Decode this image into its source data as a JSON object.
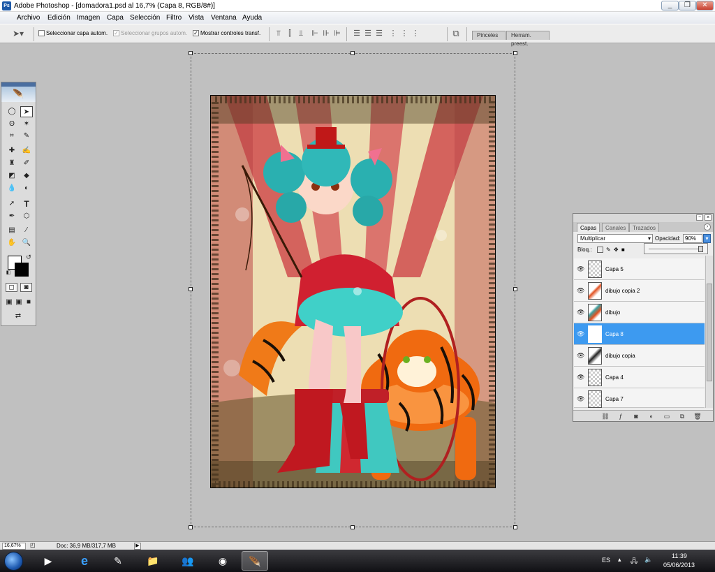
{
  "window": {
    "title": "Adobe Photoshop - [domadora1.psd al 16,7% (Capa 8, RGB/8#)]",
    "buttons": [
      "_",
      "❐",
      "✕"
    ],
    "doc_buttons": [
      "_",
      "❐",
      "✕"
    ]
  },
  "menu": [
    "Archivo",
    "Edición",
    "Imagen",
    "Capa",
    "Selección",
    "Filtro",
    "Vista",
    "Ventana",
    "Ayuda"
  ],
  "options": {
    "auto_select_layer": "Seleccionar capa autom.",
    "auto_select_groups": "Seleccionar grupos autom.",
    "show_transform": "Mostrar controles transf."
  },
  "palette_tabs": [
    "Pinceles",
    "Herram. preest."
  ],
  "layers_panel": {
    "tabs": [
      "Capas",
      "Canales",
      "Trazados"
    ],
    "blend_mode": "Multiplicar",
    "opacity_label": "Opacidad:",
    "opacity_value": "90%",
    "lock_label": "Bloq.:",
    "layers": [
      {
        "name": "Capa 5",
        "active": false
      },
      {
        "name": "dibujo copia 2",
        "active": false
      },
      {
        "name": "dibujo",
        "active": false
      },
      {
        "name": "Capa 8",
        "active": true
      },
      {
        "name": "dibujo copia",
        "active": false
      },
      {
        "name": "Capa 4",
        "active": false
      },
      {
        "name": "Capa 7",
        "active": false
      }
    ]
  },
  "status": {
    "zoom": "16,67%",
    "doc": "Doc: 36,9 MB/317,7 MB"
  },
  "taskbar": {
    "lang": "ES",
    "time": "11:39",
    "date": "05/06/2013"
  },
  "colors": {
    "accent_selection": "#3d9af0",
    "taskbar": "#1a1a1e"
  },
  "icons": {
    "tools": [
      "marquee-icon",
      "move-icon",
      "lasso-icon",
      "magic-wand-icon",
      "crop-icon",
      "eyedropper-icon",
      "healing-icon",
      "brush-icon",
      "stamp-icon",
      "history-brush-icon",
      "eraser-icon",
      "bucket-icon",
      "blur-icon",
      "dodge-icon",
      "path-select-icon",
      "text-icon",
      "pen-icon",
      "shape-icon",
      "notes-icon",
      "eyedropper2-icon",
      "hand-icon",
      "zoom-icon"
    ]
  }
}
